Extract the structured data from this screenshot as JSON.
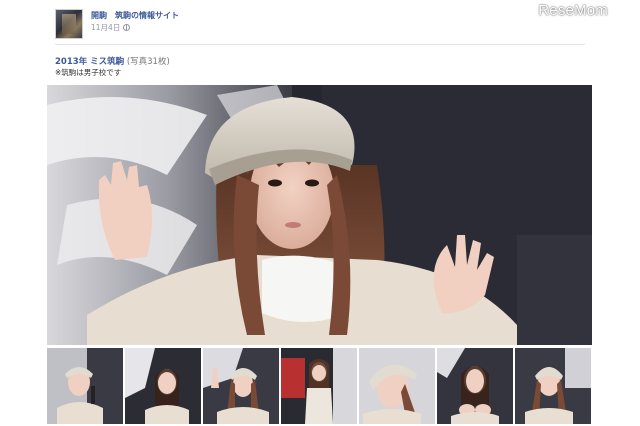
{
  "watermark": {
    "text": "ReseMom"
  },
  "post": {
    "page_name": "開駒　筑駒の情報サイト",
    "date": "11月4日",
    "privacy_icon": "globe-icon"
  },
  "album": {
    "title": "2013年 ミス筑駒",
    "photo_count": "(写真31枚)",
    "note": "※筑駒は男子校です"
  },
  "thumbnails": [
    {
      "icon": "photo-thumbnail"
    },
    {
      "icon": "photo-thumbnail"
    },
    {
      "icon": "photo-thumbnail"
    },
    {
      "icon": "photo-thumbnail"
    },
    {
      "icon": "photo-thumbnail"
    },
    {
      "icon": "photo-thumbnail"
    },
    {
      "icon": "photo-thumbnail"
    }
  ],
  "colors": {
    "link": "#3b5998",
    "meta": "#9197a3",
    "background": "#ffffff"
  }
}
